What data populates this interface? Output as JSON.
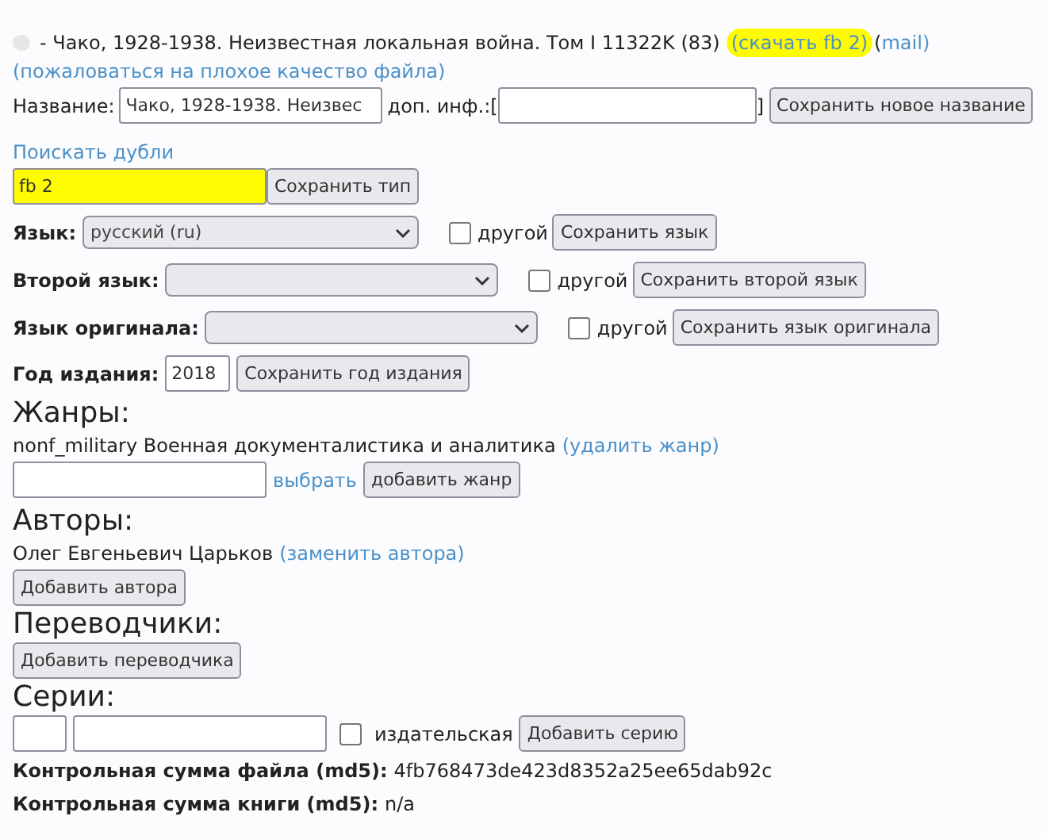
{
  "header": {
    "title": "- Чако, 1928-1938. Неизвестная локальная война. Том I 11322K (83)",
    "download_link": {
      "label": "(скачать fb 2)",
      "highlighted": true
    },
    "mail_paren": "(",
    "mail_link": "mail)",
    "complaint_link": "(пожаловаться на плохое качество файла)"
  },
  "name_row": {
    "label": "Название:",
    "value": "Чако, 1928-1938. Неизвес",
    "extra_label": "доп. инф.:[",
    "extra_close": "]",
    "button": "Сохранить новое название"
  },
  "duplicates_link": "Поискать дубли",
  "type_row": {
    "value": "fb 2",
    "highlighted": true,
    "button": "Сохранить тип"
  },
  "language_rows": [
    {
      "label": "Язык:",
      "value": "русский (ru)",
      "other_label": "другой",
      "other_checked": false,
      "button": "Сохранить язык"
    },
    {
      "label": "Второй язык:",
      "other_label": "другой",
      "other_checked": false,
      "button": "Сохранить второй язык"
    },
    {
      "label": "Язык оригинала:",
      "other_label": "другой",
      "other_checked": false,
      "button": "Сохранить язык оригинала"
    }
  ],
  "year_row": {
    "label": "Год издания:",
    "value": "2018",
    "button": "Сохранить год издания"
  },
  "genres": {
    "heading": "Жанры:",
    "items": [
      {
        "text": "nonf_military Военная документалистика и аналитика",
        "link": "(удалить жанр)"
      }
    ],
    "choose_link": "выбрать",
    "button": "добавить жанр"
  },
  "authors": {
    "heading": "Авторы:",
    "items": [
      {
        "text": "Олег Евгеньевич Царьков",
        "link": "(заменить автора)"
      }
    ],
    "button": "Добавить автора"
  },
  "translators": {
    "heading": "Переводчики:",
    "button": "Добавить переводчика"
  },
  "series": {
    "heading": "Серии:",
    "publisher_label": "издательская",
    "publisher_checked": false,
    "button": "Добавить серию"
  },
  "checksums": [
    {
      "label": "Контрольная сумма файла (md5):",
      "value": "4fb768473de423d8352a25ee65dab92c"
    },
    {
      "label": "Контрольная сумма книги (md5):",
      "value": "n/a"
    }
  ]
}
